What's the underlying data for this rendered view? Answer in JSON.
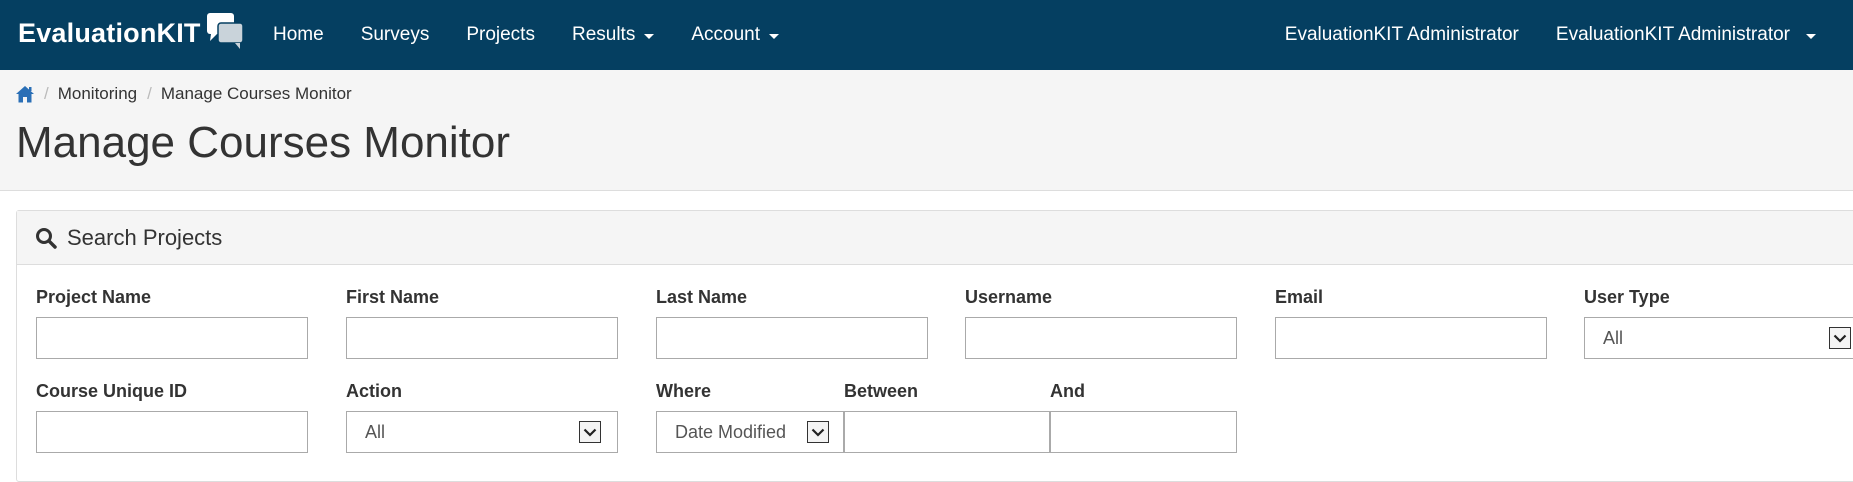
{
  "navbar": {
    "brand": "EvaluationKIT",
    "items": [
      {
        "label": "Home"
      },
      {
        "label": "Surveys"
      },
      {
        "label": "Projects"
      },
      {
        "label": "Results"
      },
      {
        "label": "Account"
      }
    ],
    "right_items": [
      {
        "label": "EvaluationKIT Administrator"
      },
      {
        "label": "EvaluationKIT Administrator"
      }
    ]
  },
  "breadcrumb": {
    "items": [
      "Monitoring",
      "Manage Courses Monitor"
    ]
  },
  "page_title": "Manage Courses Monitor",
  "search_panel": {
    "title": "Search Projects",
    "fields": {
      "project_name": {
        "label": "Project Name",
        "value": ""
      },
      "first_name": {
        "label": "First Name",
        "value": ""
      },
      "last_name": {
        "label": "Last Name",
        "value": ""
      },
      "username": {
        "label": "Username",
        "value": ""
      },
      "email": {
        "label": "Email",
        "value": ""
      },
      "user_type": {
        "label": "User Type",
        "value": "All"
      },
      "course_unique_id": {
        "label": "Course Unique ID",
        "value": ""
      },
      "action": {
        "label": "Action",
        "value": "All"
      },
      "where": {
        "label": "Where",
        "value": "Date Modified"
      },
      "between": {
        "label": "Between",
        "value": ""
      },
      "and": {
        "label": "And",
        "value": ""
      }
    }
  },
  "colors": {
    "navbar_bg": "#053f61",
    "header_bg": "#f5f5f5",
    "home_icon": "#2a6fb6"
  }
}
